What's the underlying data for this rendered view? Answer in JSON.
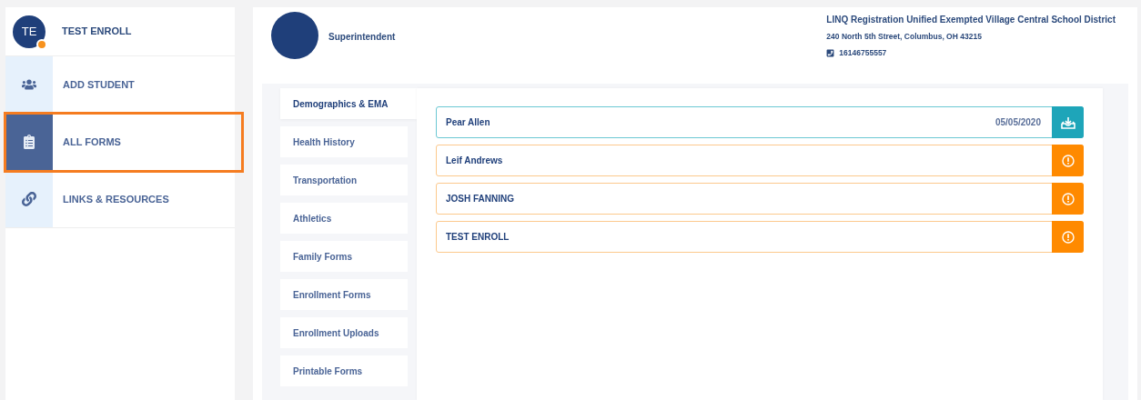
{
  "profile": {
    "initials": "TE",
    "name": "TEST ENROLL",
    "alert": true
  },
  "sidebar": {
    "items": [
      {
        "label": "ADD STUDENT",
        "selected": false
      },
      {
        "label": "ALL FORMS",
        "selected": true
      },
      {
        "label": "LINKS & RESOURCES",
        "selected": false
      }
    ]
  },
  "header": {
    "role": "Superintendent",
    "district": "LINQ Registration Unified Exempted Village Central School District",
    "address": "240 North 5th Street, Columbus, OH 43215",
    "phone": "16146755557"
  },
  "tabs": [
    {
      "label": "Demographics & EMA",
      "selected": true
    },
    {
      "label": "Health History",
      "selected": false
    },
    {
      "label": "Transportation",
      "selected": false
    },
    {
      "label": "Athletics",
      "selected": false
    },
    {
      "label": "Family Forms",
      "selected": false
    },
    {
      "label": "Enrollment Forms",
      "selected": false
    },
    {
      "label": "Enrollment Uploads",
      "selected": false
    },
    {
      "label": "Printable Forms",
      "selected": false
    }
  ],
  "forms": [
    {
      "name": "Pear Allen",
      "date": "05/05/2020",
      "kind": "complete"
    },
    {
      "name": "Leif Andrews",
      "kind": "pending"
    },
    {
      "name": "JOSH FANNING",
      "kind": "pending"
    },
    {
      "name": "TEST ENROLL",
      "kind": "pending"
    }
  ]
}
